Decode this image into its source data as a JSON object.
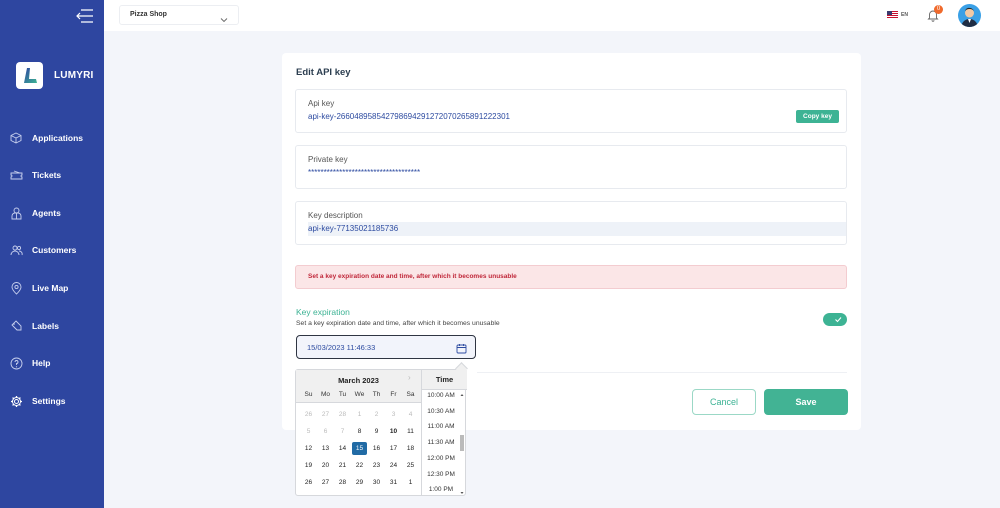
{
  "app": {
    "brand": "LUMYRI"
  },
  "sidebar": {
    "items": [
      {
        "label": "Applications",
        "icon": "box-icon"
      },
      {
        "label": "Tickets",
        "icon": "ticket-icon"
      },
      {
        "label": "Agents",
        "icon": "agent-icon"
      },
      {
        "label": "Customers",
        "icon": "users-icon"
      },
      {
        "label": "Live Map",
        "icon": "location-pin-icon"
      },
      {
        "label": "Labels",
        "icon": "tag-icon"
      },
      {
        "label": "Help",
        "icon": "help-circle-icon"
      },
      {
        "label": "Settings",
        "icon": "gear-icon"
      }
    ]
  },
  "topbar": {
    "shop_selected": "Pizza Shop",
    "language": "EN",
    "notification_count": "0"
  },
  "form": {
    "title": "Edit API key",
    "api_key_label": "Api key",
    "api_key_value": "api-key-266048958542798694291272070265891222301",
    "copy_label": "Copy key",
    "private_key_label": "Private key",
    "private_key_value": "************************************",
    "description_label": "Key description",
    "description_value": "api-key-77135021185736",
    "alert_text": "Set a key expiration date and time, after which it becomes unusable",
    "expiration_title": "Key expiration",
    "expiration_subtitle": "Set a key expiration date and time, after which it becomes unusable",
    "expiration_enabled": true,
    "expiration_value": "15/03/2023 11:46:33",
    "cancel_label": "Cancel",
    "save_label": "Save"
  },
  "datepicker": {
    "month": "March 2023",
    "weekdays": [
      "Su",
      "Mo",
      "Tu",
      "We",
      "Th",
      "Fr",
      "Sa"
    ],
    "weeks": [
      [
        "26",
        "27",
        "28",
        "1",
        "2",
        "3",
        "4"
      ],
      [
        "5",
        "6",
        "7",
        "8",
        "9",
        "10",
        "11"
      ],
      [
        "12",
        "13",
        "14",
        "15",
        "16",
        "17",
        "18"
      ],
      [
        "19",
        "20",
        "21",
        "22",
        "23",
        "24",
        "25"
      ],
      [
        "26",
        "27",
        "28",
        "29",
        "30",
        "31",
        "1"
      ]
    ],
    "disabled_through_index": 11,
    "today_index": 12,
    "selected_day": "15",
    "time_label": "Time",
    "times": [
      "10:00 AM",
      "10:30 AM",
      "11:00 AM",
      "11:30 AM",
      "12:00 PM",
      "12:30 PM",
      "1:00 PM"
    ]
  }
}
